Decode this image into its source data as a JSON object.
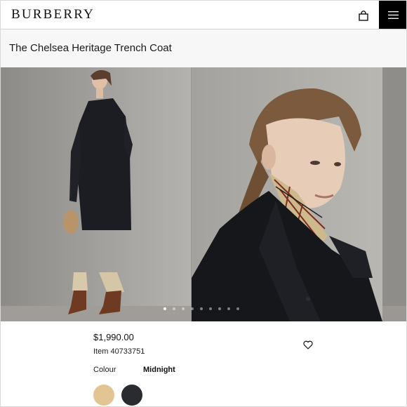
{
  "header": {
    "brand": "BURBERRY",
    "bag_icon": "shopping-bag-icon",
    "menu_icon": "hamburger-menu-icon"
  },
  "product": {
    "title": "The Chelsea Heritage Trench Coat",
    "price": "$1,990.00",
    "item_number": "Item 40733751",
    "wishlist_icon": "heart-icon",
    "colour_label": "Colour",
    "colour_selected": "Midnight",
    "swatches": [
      {
        "name": "Honey",
        "color": "#e3c594"
      },
      {
        "name": "Midnight",
        "color": "#2a2b30"
      }
    ]
  },
  "gallery": {
    "slide_count": 9,
    "active_slide": 1,
    "images": [
      "model-full-length-trench-coat",
      "model-close-up-collar",
      "next-image-partial"
    ]
  },
  "colors": {
    "header_menu_bg": "#000000",
    "title_bar_bg": "#f7f7f7"
  }
}
